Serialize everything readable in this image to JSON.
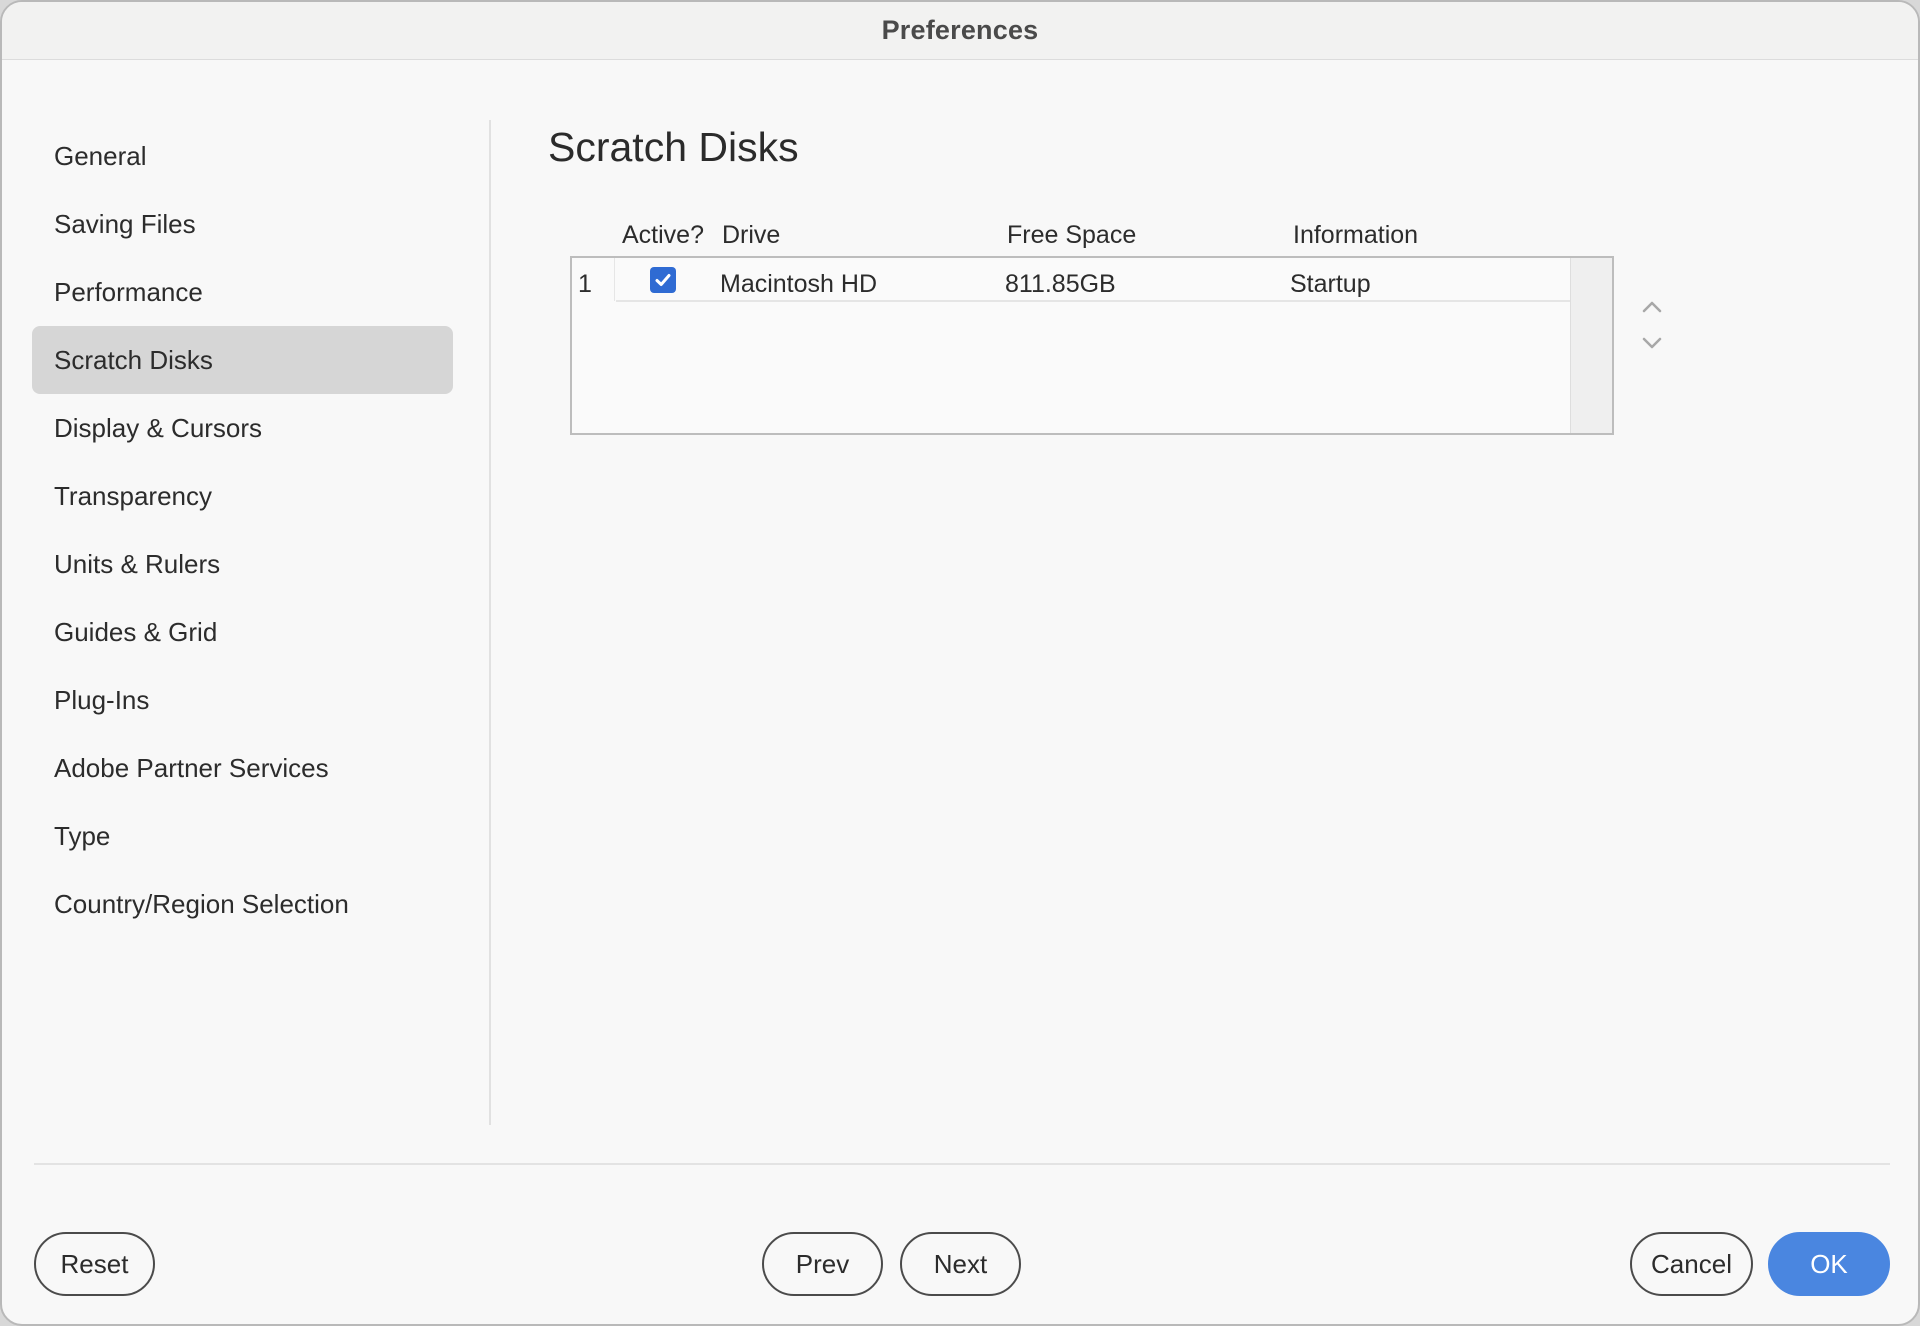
{
  "window": {
    "title": "Preferences"
  },
  "sidebar": {
    "items": [
      {
        "label": "General",
        "selected": false
      },
      {
        "label": "Saving Files",
        "selected": false
      },
      {
        "label": "Performance",
        "selected": false
      },
      {
        "label": "Scratch Disks",
        "selected": true
      },
      {
        "label": "Display & Cursors",
        "selected": false
      },
      {
        "label": "Transparency",
        "selected": false
      },
      {
        "label": "Units & Rulers",
        "selected": false
      },
      {
        "label": "Guides & Grid",
        "selected": false
      },
      {
        "label": "Plug-Ins",
        "selected": false
      },
      {
        "label": "Adobe Partner Services",
        "selected": false
      },
      {
        "label": "Type",
        "selected": false
      },
      {
        "label": "Country/Region Selection",
        "selected": false
      }
    ]
  },
  "main": {
    "title": "Scratch Disks",
    "table": {
      "columns": {
        "active": "Active?",
        "drive": "Drive",
        "free_space": "Free Space",
        "information": "Information"
      },
      "rows": [
        {
          "index": "1",
          "active": true,
          "drive": "Macintosh HD",
          "free_space": "811.85GB",
          "information": "Startup"
        }
      ]
    },
    "move_up_icon": "chevron-up-icon",
    "move_down_icon": "chevron-down-icon"
  },
  "footer": {
    "reset": "Reset",
    "prev": "Prev",
    "next": "Next",
    "cancel": "Cancel",
    "ok": "OK"
  },
  "colors": {
    "accent": "#4a86e0",
    "checkbox": "#2f6bd3",
    "selected_item": "#d6d6d6"
  }
}
